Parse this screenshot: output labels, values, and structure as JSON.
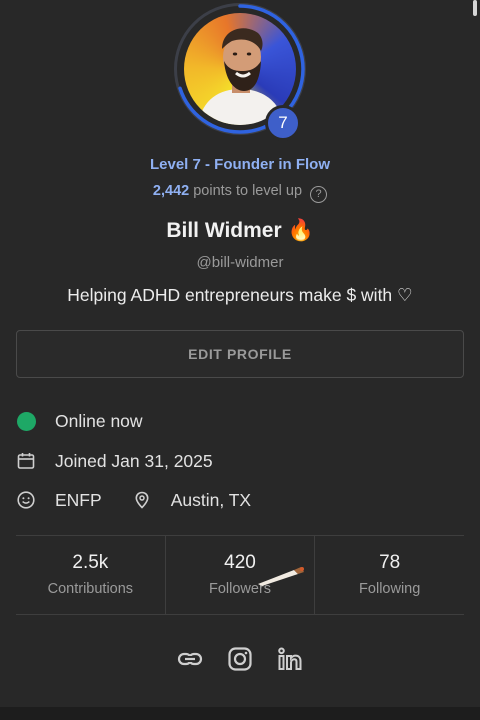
{
  "profile": {
    "level_badge": "7",
    "level_title": "Level 7 - Founder in Flow",
    "points_number": "2,442",
    "points_suffix": "points to level up",
    "help_glyph": "?",
    "name": "Bill Widmer",
    "name_emoji": "🔥",
    "handle": "@bill-widmer",
    "bio": "Helping ADHD entrepreneurs make $ with ♡",
    "level_progress": 0.7
  },
  "actions": {
    "edit_profile": "EDIT PROFILE"
  },
  "details": {
    "status": "Online now",
    "joined": "Joined Jan 31, 2025",
    "personality": "ENFP",
    "location": "Austin, TX"
  },
  "stats": [
    {
      "value": "2.5k",
      "label": "Contributions"
    },
    {
      "value": "420",
      "label": "Followers"
    },
    {
      "value": "78",
      "label": "Following"
    }
  ],
  "socials": [
    "link-icon",
    "instagram-icon",
    "linkedin-icon"
  ],
  "colors": {
    "background": "#282828",
    "accent": "#8fb0f2",
    "badge": "#3e5fc9",
    "online": "#1ea866",
    "muted": "#9a9a9a"
  }
}
